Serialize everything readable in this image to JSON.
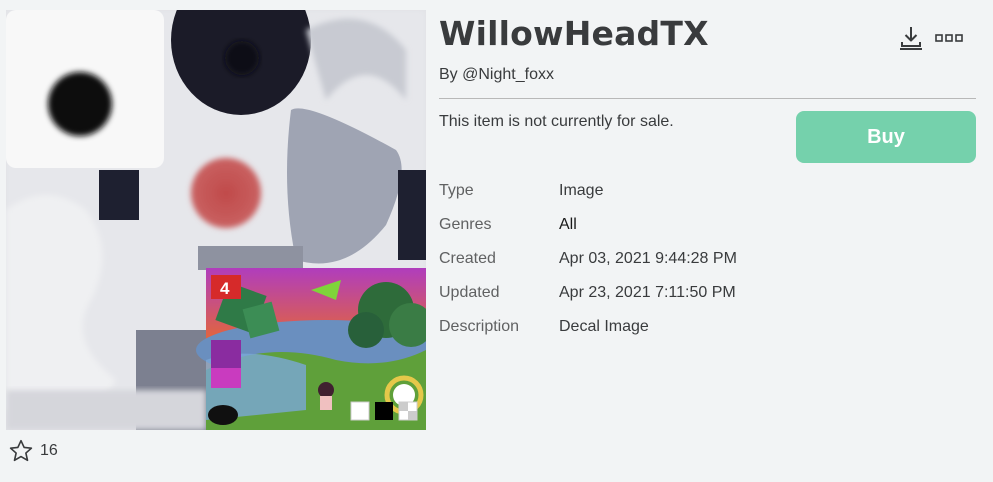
{
  "item": {
    "title": "WillowHeadTX",
    "creator_prefix": "By ",
    "creator": "@Night_foxx",
    "sale_status": "This item is not currently for sale.",
    "buy_label": "Buy",
    "favorites": "16"
  },
  "details": [
    {
      "label": "Type",
      "value": "Image"
    },
    {
      "label": "Genres",
      "value": "All"
    },
    {
      "label": "Created",
      "value": "Apr 03, 2021 9:44:28 PM"
    },
    {
      "label": "Updated",
      "value": "Apr 23, 2021 7:11:50 PM"
    },
    {
      "label": "Description",
      "value": "Decal Image"
    }
  ],
  "thumbnail_overlay": {
    "flag_number": "4"
  },
  "icons": {
    "download": "download-icon",
    "more": "more-options-icon",
    "favorite": "star-icon"
  },
  "colors": {
    "background": "#f2f4f5",
    "buy_button": "#75d1ac",
    "text": "#393b3d",
    "divider": "#b8b8b8"
  }
}
